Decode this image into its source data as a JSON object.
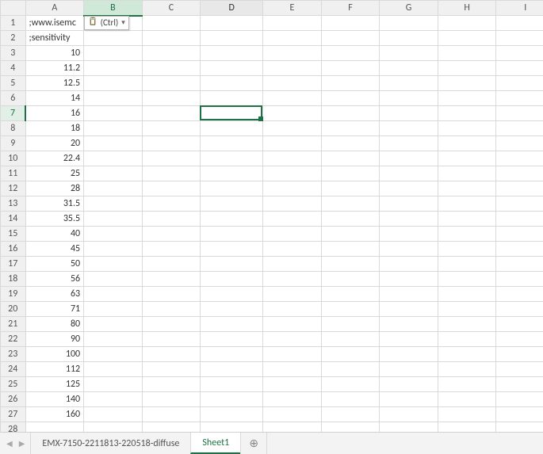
{
  "columns": [
    "A",
    "B",
    "C",
    "D",
    "E",
    "F",
    "G",
    "H",
    "I"
  ],
  "highlight_col_index": 1,
  "active_col_index": 3,
  "active_row_index": 6,
  "row_count": 28,
  "colA": {
    "1": ";www.isemc",
    "2": ";sensitivity",
    "3": "10",
    "4": "11.2",
    "5": "12.5",
    "6": "14",
    "7": "16",
    "8": "18",
    "9": "20",
    "10": "22.4",
    "11": "25",
    "12": "28",
    "13": "31.5",
    "14": "35.5",
    "15": "40",
    "16": "45",
    "17": "50",
    "18": "56",
    "19": "63",
    "20": "71",
    "21": "80",
    "22": "90",
    "23": "100",
    "24": "112",
    "25": "125",
    "26": "140",
    "27": "160"
  },
  "paste_tag": {
    "label": "(Ctrl)"
  },
  "tabs": [
    {
      "label": "EMX-7150-2211813-220518-diffuse",
      "active": false
    },
    {
      "label": "Sheet1",
      "active": true
    }
  ]
}
